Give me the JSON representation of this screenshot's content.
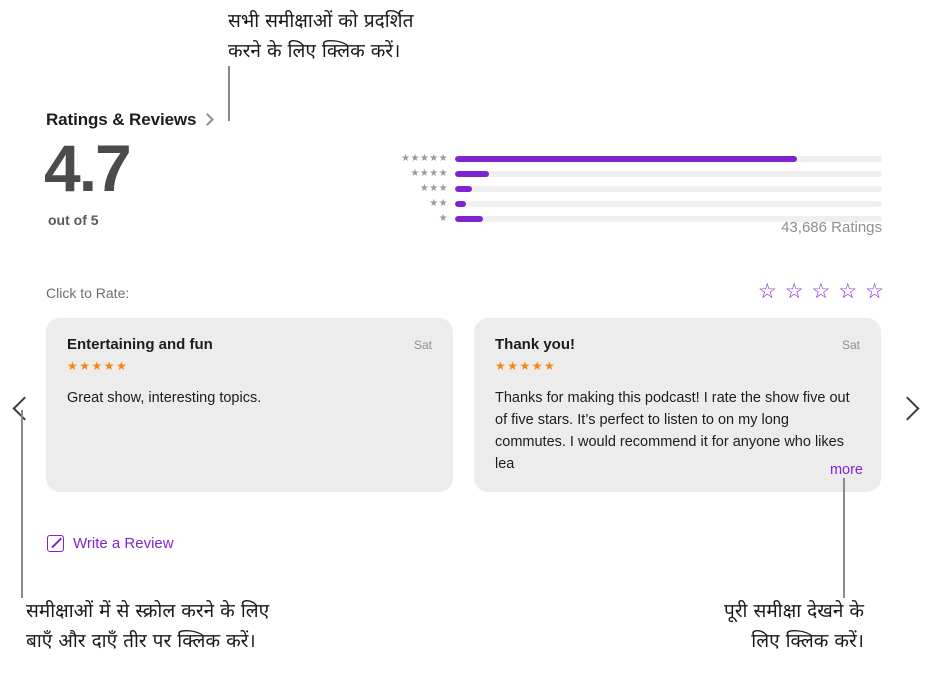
{
  "callouts": {
    "top": "सभी समीक्षाओं को प्रदर्शित\nकरने के लिए क्लिक करें।",
    "bottom_left": "समीक्षाओं में से स्क्रोल करने के लिए\nबाएँ और दाएँ तीर पर क्लिक करें।",
    "bottom_right": "पूरी समीक्षा देखने के\nलिए क्लिक करें।"
  },
  "section": {
    "title": "Ratings & Reviews",
    "chevron_icon": "chevron-right-icon"
  },
  "summary": {
    "average": "4.7",
    "out_of": "out of 5",
    "ratings_count": "43,686 Ratings"
  },
  "chart_data": {
    "type": "bar",
    "title": "Ratings & Reviews",
    "orientation": "horizontal",
    "categories": [
      "★★★★★",
      "★★★★",
      "★★★",
      "★★",
      "★"
    ],
    "values": [
      80,
      8,
      4,
      2.5,
      6.5
    ],
    "xlabel": "",
    "ylabel": "",
    "xlim": [
      0,
      100
    ],
    "grid": false,
    "legend": false,
    "bar_color": "#8024d1",
    "track_color": "#efefef",
    "average": 4.7,
    "total_ratings": 43686
  },
  "rate": {
    "label": "Click to Rate:",
    "stars": [
      "☆",
      "☆",
      "☆",
      "☆",
      "☆"
    ],
    "star_color": "#8024d1"
  },
  "reviews": [
    {
      "title": "Entertaining and fun",
      "date": "Sat",
      "stars": "★★★★★",
      "body": "Great show, interesting topics.",
      "more_label": ""
    },
    {
      "title": "Thank you!",
      "date": "Sat",
      "stars": "★★★★★",
      "body": "Thanks for making this podcast! I rate the show five out of five stars. It’s perfect to listen to on my long commutes. I would recommend it for anyone who likes lea",
      "more_label": "more"
    }
  ],
  "nav": {
    "prev_icon": "chevron-left-icon",
    "next_icon": "chevron-right-icon"
  },
  "write_review": {
    "label": "Write a Review",
    "icon": "compose-icon"
  },
  "colors": {
    "accent": "#8024d1",
    "star_filled": "#f5860f",
    "card_bg": "#ececec"
  }
}
